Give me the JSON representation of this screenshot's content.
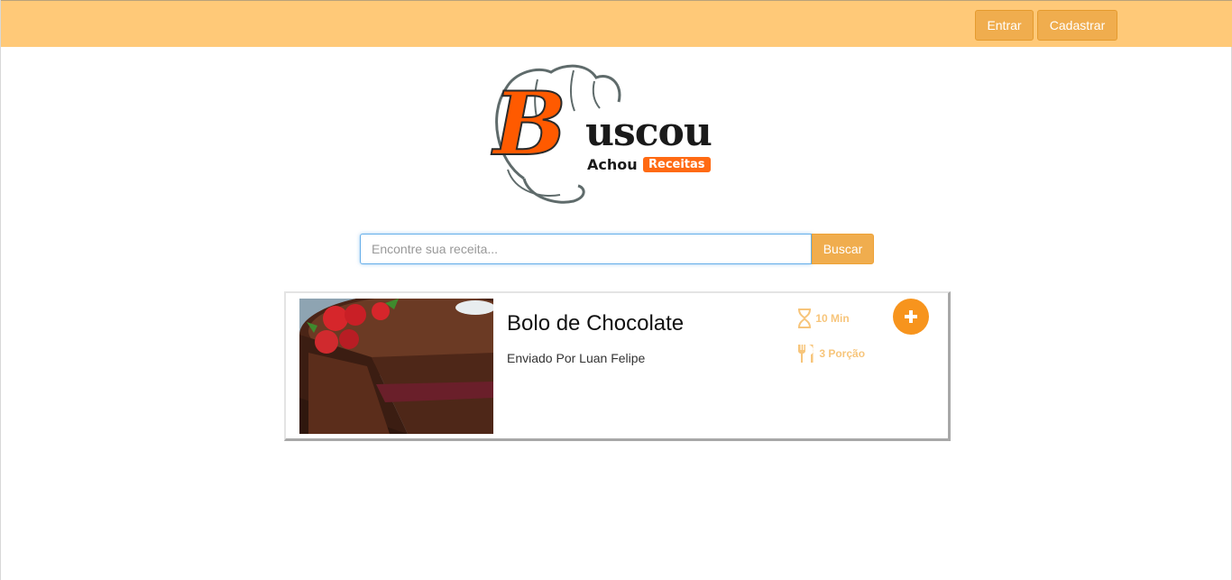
{
  "header": {
    "login_label": "Entrar",
    "signup_label": "Cadastrar",
    "background_color": "#ffc978",
    "button_color": "#f0ad4e"
  },
  "logo": {
    "main_text": "uscou",
    "initial": "B",
    "sub_text": "Achou",
    "badge_text": "Receitas",
    "icon": "chef-hat-icon",
    "accent_color": "#ff5a00"
  },
  "search": {
    "placeholder": "Encontre sua receita...",
    "value": "",
    "button_label": "Buscar"
  },
  "recipes": [
    {
      "title": "Bolo de Chocolate",
      "author": "Enviado Por Luan Felipe",
      "time": "10 Min",
      "servings": "3 Porção",
      "image": "chocolate-cake-photo",
      "time_icon": "hourglass-icon",
      "servings_icon": "cutlery-icon",
      "add_icon": "plus-icon"
    }
  ]
}
